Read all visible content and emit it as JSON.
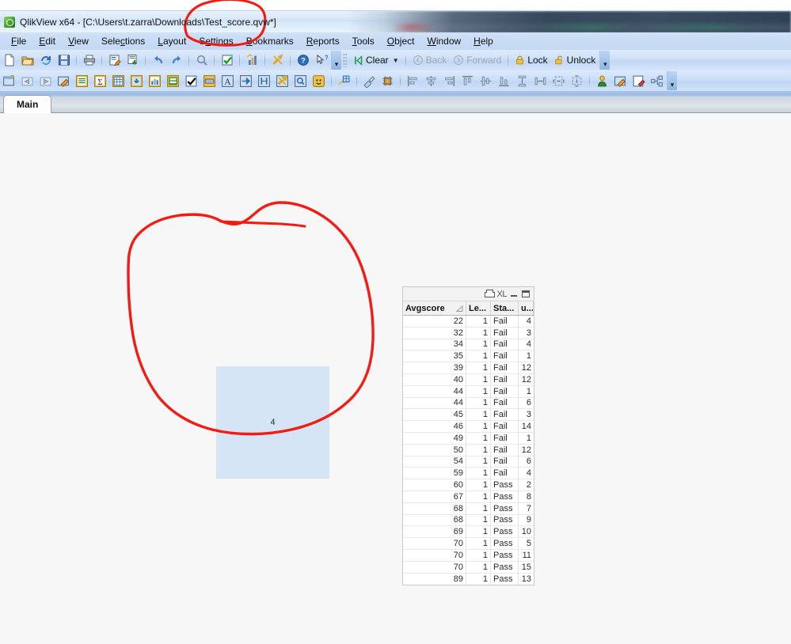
{
  "window": {
    "title": "QlikView x64 - [C:\\Users\\t.zarra\\Downloads\\Test_score.qvw*]",
    "app_icon": "qlikview-logo-icon"
  },
  "menubar": {
    "items": [
      {
        "label": "File",
        "accel": "F"
      },
      {
        "label": "Edit",
        "accel": "E"
      },
      {
        "label": "View",
        "accel": "V"
      },
      {
        "label": "Selections",
        "accel": "S"
      },
      {
        "label": "Layout",
        "accel": "L"
      },
      {
        "label": "Settings",
        "accel": "S"
      },
      {
        "label": "Bookmarks",
        "accel": "B"
      },
      {
        "label": "Reports",
        "accel": "R"
      },
      {
        "label": "Tools",
        "accel": "T"
      },
      {
        "label": "Object",
        "accel": "O"
      },
      {
        "label": "Window",
        "accel": "W"
      },
      {
        "label": "Help",
        "accel": "H"
      }
    ]
  },
  "toolbar_standard": {
    "icons": [
      "new-document-icon",
      "open-folder-icon",
      "reload-icon",
      "save-icon",
      "sep",
      "print-icon",
      "sep",
      "edit-script-icon",
      "table-viewer-icon",
      "sep",
      "undo-icon",
      "redo-icon",
      "sep",
      "search-icon",
      "sep",
      "current-selections-icon",
      "sep",
      "chart-wizard-icon",
      "sep",
      "clear-all-icon",
      "sep",
      "help-icon",
      "context-help-icon"
    ],
    "clear_label": "Clear",
    "back_label": "Back",
    "forward_label": "Forward",
    "lock_label": "Lock",
    "unlock_label": "Unlock",
    "clear_icon": "clear-selections-icon",
    "back_icon": "back-arrow-icon",
    "forward_icon": "forward-arrow-icon",
    "lock_icon": "lock-closed-icon",
    "unlock_icon": "lock-open-icon",
    "overflow_icon": "toolbar-overflow-icon"
  },
  "toolbar_design": {
    "icons": [
      "new-sheet-icon",
      "previous-sheet-icon",
      "next-sheet-icon",
      "sheet-properties-icon",
      "list-box-icon",
      "statistics-box-icon",
      "table-box-icon",
      "multi-box-icon",
      "chart-icon",
      "input-box-icon",
      "current-selections-box-icon",
      "button-icon",
      "text-object-icon",
      "line-arrow-object-icon",
      "slider-calendar-object-icon",
      "bookmark-object-icon",
      "search-object-icon",
      "container-object-icon",
      "sep",
      "design-grid-icon",
      "sep",
      "copy-format-icon",
      "snap-to-grid-icon",
      "sep",
      "align-left-icon",
      "align-center-horizontal-icon",
      "align-right-icon",
      "align-top-icon",
      "align-middle-icon",
      "align-bottom-icon",
      "space-vertically-icon",
      "space-horizontally-icon",
      "shrink-width-icon",
      "adjust-height-icon",
      "sep",
      "promote-object-icon",
      "sheet-properties-2-icon",
      "document-properties-icon",
      "object-layers-icon"
    ],
    "overflow_icon": "toolbar-overflow-icon"
  },
  "sheets": {
    "tabs": [
      {
        "label": "Main",
        "active": true
      }
    ]
  },
  "objects": {
    "textbox": {
      "value": "4",
      "background": "#d6e5f6"
    }
  },
  "table": {
    "caption": {
      "print_icon": "print-icon",
      "export_label": "XL",
      "minimize_icon": "minimize-icon",
      "maximize_icon": "maximize-icon"
    },
    "columns": [
      {
        "label": "Avgscore",
        "sorted": true,
        "sort_icon": "sort-ascending-icon"
      },
      {
        "label": "Le...",
        "sorted": false
      },
      {
        "label": "Sta...",
        "sorted": false
      },
      {
        "label": "u...",
        "sorted": false
      }
    ],
    "rows": [
      [
        "22",
        "1",
        "Fail",
        "4"
      ],
      [
        "32",
        "1",
        "Fail",
        "3"
      ],
      [
        "34",
        "1",
        "Fail",
        "4"
      ],
      [
        "35",
        "1",
        "Fail",
        "1"
      ],
      [
        "39",
        "1",
        "Fail",
        "12"
      ],
      [
        "40",
        "1",
        "Fail",
        "12"
      ],
      [
        "44",
        "1",
        "Fail",
        "1"
      ],
      [
        "44",
        "1",
        "Fail",
        "6"
      ],
      [
        "45",
        "1",
        "Fail",
        "3"
      ],
      [
        "46",
        "1",
        "Fail",
        "14"
      ],
      [
        "49",
        "1",
        "Fail",
        "1"
      ],
      [
        "50",
        "1",
        "Fail",
        "12"
      ],
      [
        "54",
        "1",
        "Fail",
        "6"
      ],
      [
        "59",
        "1",
        "Fail",
        "4"
      ],
      [
        "60",
        "1",
        "Pass",
        "2"
      ],
      [
        "67",
        "1",
        "Pass",
        "8"
      ],
      [
        "68",
        "1",
        "Pass",
        "7"
      ],
      [
        "68",
        "1",
        "Pass",
        "9"
      ],
      [
        "69",
        "1",
        "Pass",
        "10"
      ],
      [
        "70",
        "1",
        "Pass",
        "5"
      ],
      [
        "70",
        "1",
        "Pass",
        "11"
      ],
      [
        "70",
        "1",
        "Pass",
        "15"
      ],
      [
        "89",
        "1",
        "Pass",
        "13"
      ]
    ]
  },
  "annotations": {
    "color": "#f41b12",
    "marks": [
      {
        "name": "title-filename-circle",
        "shape": "ellipse"
      },
      {
        "name": "object-circle",
        "shape": "freehand-circle"
      }
    ]
  }
}
